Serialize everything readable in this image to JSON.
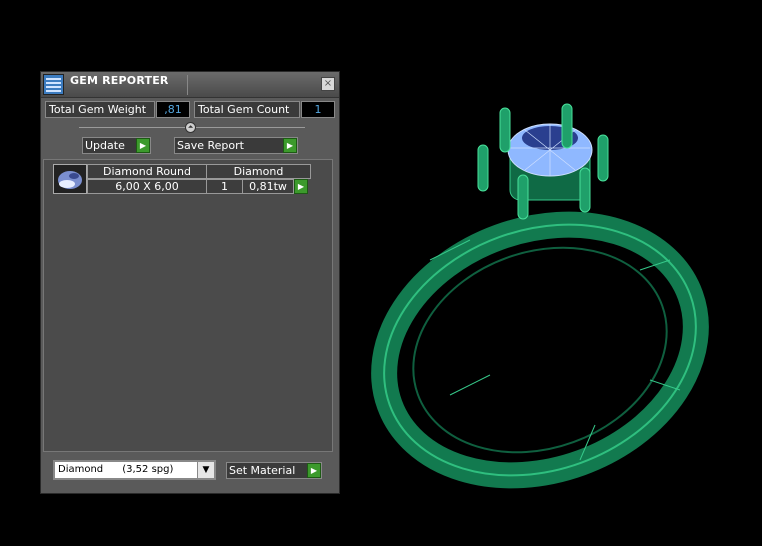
{
  "panel": {
    "title": "GEM REPORTER",
    "close_glyph": "×",
    "total_weight_label": "Total Gem Weight",
    "total_weight_value": ",81",
    "total_count_label": "Total Gem Count",
    "total_count_value": "1",
    "collapse_glyph": "⏶",
    "update_label": "Update",
    "save_report_label": "Save Report",
    "go_glyph": "▶"
  },
  "gem_list": {
    "rows": [
      {
        "shape": "Diamond Round",
        "material": "Diamond",
        "size": "6,00 X 6,00",
        "count": "1",
        "weight": "0,81tw"
      }
    ]
  },
  "footer": {
    "material_select": "Diamond      (3,52 spg)",
    "dropdown_glyph": "▼",
    "set_material_label": "Set Material"
  },
  "colors": {
    "accent_green": "#3c9a2c",
    "value_blue": "#56a8e0",
    "ring_green": "#1f8f5f",
    "gem_blue": "#8fb8ff"
  },
  "icons": {
    "title": "gem-reporter-icon",
    "thumbnail": "diamond-thumbnail-icon"
  }
}
